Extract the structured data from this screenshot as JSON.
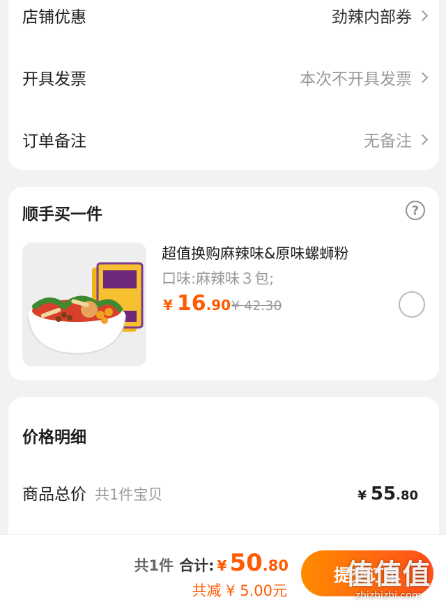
{
  "order_options": {
    "rows": [
      {
        "label": "店铺优惠",
        "value": "劲辣内部券",
        "emphasis": true
      },
      {
        "label": "开具发票",
        "value": "本次不开具发票",
        "emphasis": false
      },
      {
        "label": "订单备注",
        "value": "无备注",
        "emphasis": false
      }
    ]
  },
  "addon": {
    "title": "顺手买一件",
    "help_icon": "?",
    "product": {
      "title": "超值换购麻辣味&原味螺蛳粉",
      "spec": "口味:麻辣味３包;",
      "currency": "¥",
      "price_int": "16",
      "price_dec": ".90",
      "old_price": "¥ 42.30",
      "image_label": "螺蛳粉"
    }
  },
  "price_detail": {
    "title": "价格明细",
    "goods_total_label": "商品总价",
    "goods_count": "共1件宝贝",
    "goods_total_currency": "¥",
    "goods_total_int": "55",
    "goods_total_dec": ".80"
  },
  "bottom_bar": {
    "count": "共1件",
    "total_label": "合计:",
    "currency": "¥",
    "total_int": "50",
    "total_dec": ".80",
    "saved": "共减 ¥ 5.00元",
    "submit_label": "提交订单",
    "accent": "#ff5a00"
  },
  "watermark": {
    "logo": "值值值",
    "url": "zhizhizhi.com"
  }
}
